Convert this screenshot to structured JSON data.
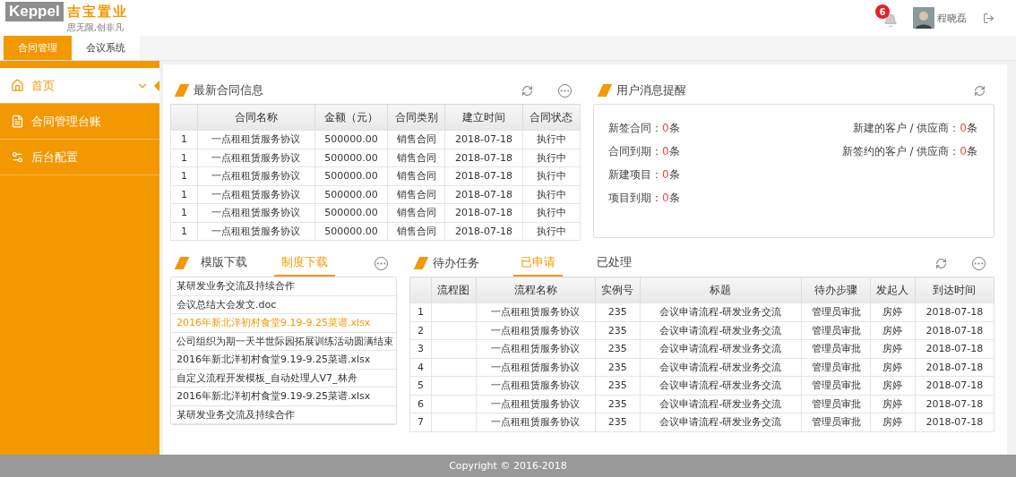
{
  "header": {
    "logo": {
      "brand": "Keppel",
      "name": "吉宝置业",
      "slogan": "思无限,创非凡"
    },
    "notifications": "6",
    "user": "程晓磊"
  },
  "top_tabs": [
    {
      "label": "合同管理",
      "selected": true
    },
    {
      "label": "会议系统",
      "selected": false
    }
  ],
  "sidebar": {
    "items": [
      {
        "label": "首页",
        "selected": true
      },
      {
        "label": "合同管理台账",
        "selected": false
      },
      {
        "label": "后台配置",
        "selected": false
      }
    ]
  },
  "contracts": {
    "title": "最新合同信息",
    "columns": [
      "",
      "合同名称",
      "金额（元）",
      "合同类别",
      "建立时间",
      "合同状态"
    ],
    "rows": [
      [
        "1",
        "一点租租赁服务协议",
        "500000.00",
        "销售合同",
        "2018-07-18",
        "执行中"
      ],
      [
        "1",
        "一点租租赁服务协议",
        "500000.00",
        "销售合同",
        "2018-07-18",
        "执行中"
      ],
      [
        "1",
        "一点租租赁服务协议",
        "500000.00",
        "销售合同",
        "2018-07-18",
        "执行中"
      ],
      [
        "1",
        "一点租租赁服务协议",
        "500000.00",
        "销售合同",
        "2018-07-18",
        "执行中"
      ],
      [
        "1",
        "一点租租赁服务协议",
        "500000.00",
        "销售合同",
        "2018-07-18",
        "执行中"
      ],
      [
        "1",
        "一点租租赁服务协议",
        "500000.00",
        "销售合同",
        "2018-07-18",
        "执行中"
      ]
    ]
  },
  "messages": {
    "title": "用户消息提醒",
    "left": [
      {
        "label": "新签合同：",
        "count": "0",
        "unit": "条"
      },
      {
        "label": "合同到期：",
        "count": "0",
        "unit": "条"
      },
      {
        "label": "新建项目：",
        "count": "0",
        "unit": "条"
      },
      {
        "label": "项目到期：",
        "count": "0",
        "unit": "条"
      }
    ],
    "right": [
      {
        "label": "新建的客户 / 供应商：",
        "count": "0",
        "unit": "条"
      },
      {
        "label": "新签约的客户 / 供应商：",
        "count": "0",
        "unit": "条"
      }
    ]
  },
  "downloads": {
    "tabs": [
      {
        "label": "模版下载",
        "selected": false
      },
      {
        "label": "制度下载",
        "selected": true
      }
    ],
    "items": [
      {
        "label": "某研发业务交流及持续合作",
        "selected": false
      },
      {
        "label": "会议总结大会发文.doc",
        "selected": false
      },
      {
        "label": "2016年新北洋初村食堂9.19-9.25菜谱.xlsx",
        "selected": true
      },
      {
        "label": "公司组织为期一天半世际园拓展训练活动圆满结束",
        "selected": false
      },
      {
        "label": "2016年新北洋初村食堂9.19-9.25菜谱.xlsx",
        "selected": false
      },
      {
        "label": "自定义流程开发模板_自动处理人V7_林舟",
        "selected": false
      },
      {
        "label": "2016年新北洋初村食堂9.19-9.25菜谱.xlsx",
        "selected": false
      },
      {
        "label": "某研发业务交流及持续合作",
        "selected": false
      }
    ]
  },
  "tasks": {
    "title": "待办任务",
    "tabs": [
      {
        "label": "已申请",
        "selected": true
      },
      {
        "label": "已处理",
        "selected": false
      }
    ],
    "columns": [
      "",
      "流程图",
      "流程名称",
      "实例号",
      "标题",
      "待办步骤",
      "发起人",
      "到达时间"
    ],
    "rows": [
      [
        "1",
        "",
        "一点租租赁服务协议",
        "235",
        "会议申请流程-研发业务交流",
        "管理员审批",
        "房婷",
        "2018-07-18"
      ],
      [
        "2",
        "",
        "一点租租赁服务协议",
        "235",
        "会议申请流程-研发业务交流",
        "管理员审批",
        "房婷",
        "2018-07-18"
      ],
      [
        "3",
        "",
        "一点租租赁服务协议",
        "235",
        "会议申请流程-研发业务交流",
        "管理员审批",
        "房婷",
        "2018-07-18"
      ],
      [
        "4",
        "",
        "一点租租赁服务协议",
        "235",
        "会议申请流程-研发业务交流",
        "管理员审批",
        "房婷",
        "2018-07-18"
      ],
      [
        "5",
        "",
        "一点租租赁服务协议",
        "235",
        "会议申请流程-研发业务交流",
        "管理员审批",
        "房婷",
        "2018-07-18"
      ],
      [
        "6",
        "",
        "一点租租赁服务协议",
        "235",
        "会议申请流程-研发业务交流",
        "管理员审批",
        "房婷",
        "2018-07-18"
      ],
      [
        "7",
        "",
        "一点租租赁服务协议",
        "235",
        "会议申请流程-研发业务交流",
        "管理员审批",
        "房婷",
        "2018-07-18"
      ]
    ]
  },
  "footer": "Copyright © 2016-2018"
}
